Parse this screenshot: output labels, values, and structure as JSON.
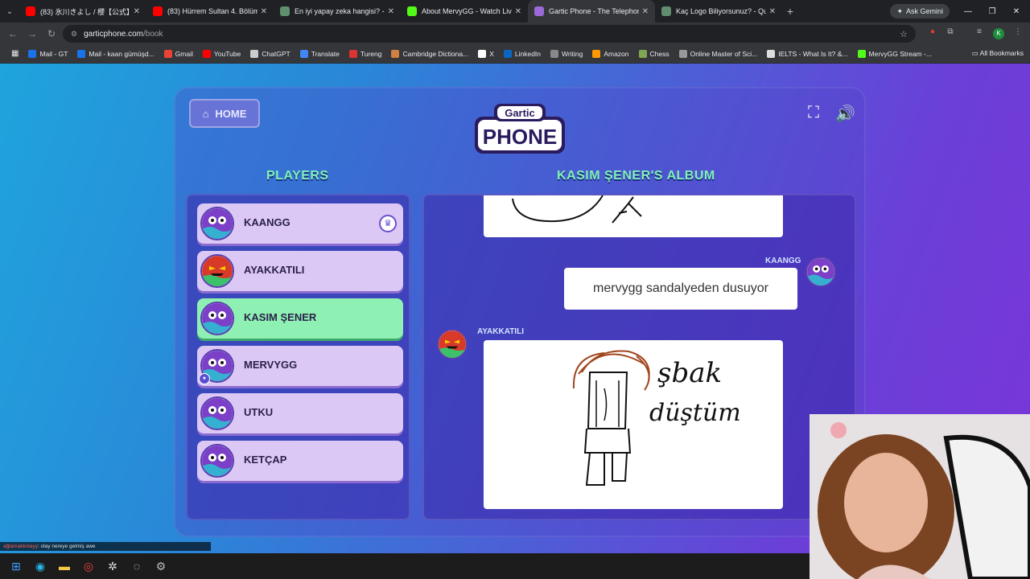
{
  "browser": {
    "tabs": [
      {
        "title": "(83) 氷川きよし / 櫻【公式】",
        "color": "#ff0000"
      },
      {
        "title": "(83) Hürrem Sultan 4. Bölüm - \\",
        "color": "#ff0000"
      },
      {
        "title": "En iyi yapay zeka hangisi? - Tie",
        "color": "#5f8f6f"
      },
      {
        "title": "About MervyGG - Watch Live o",
        "color": "#53fc18"
      },
      {
        "title": "Gartic Phone - The Telephone C",
        "color": "#9b6ad8",
        "active": true
      },
      {
        "title": "Kaç Logo Biliyorsunuz? - Quizei",
        "color": "#5f8f6f"
      }
    ],
    "gemini_label": "Ask Gemini",
    "url_host": "garticphone.com",
    "url_path": "/book",
    "profile_initial": "K",
    "bookmarks": [
      {
        "label": "Mail - GT",
        "color": "#1a73e8"
      },
      {
        "label": "Mail - kaan gümüşd...",
        "color": "#1a73e8"
      },
      {
        "label": "Gmail",
        "color": "#ea4335"
      },
      {
        "label": "YouTube",
        "color": "#ff0000"
      },
      {
        "label": "ChatGPT",
        "color": "#cccccc"
      },
      {
        "label": "Translate",
        "color": "#4285f4"
      },
      {
        "label": "Tureng",
        "color": "#d33"
      },
      {
        "label": "Cambridge Dictiona...",
        "color": "#d08040"
      },
      {
        "label": "X",
        "color": "#ffffff"
      },
      {
        "label": "LinkedIn",
        "color": "#0a66c2"
      },
      {
        "label": "Writing",
        "color": "#888888"
      },
      {
        "label": "Amazon",
        "color": "#ff9900"
      },
      {
        "label": "Chess",
        "color": "#7fa650"
      },
      {
        "label": "Online Master of Sci...",
        "color": "#999999"
      },
      {
        "label": "IELTS - What Is It? &...",
        "color": "#dddddd"
      },
      {
        "label": "MervyGG Stream -...",
        "color": "#53fc18"
      }
    ],
    "all_bookmarks": "All Bookmarks"
  },
  "game": {
    "home_label": "HOME",
    "logo_top": "Gartic",
    "logo_main": "PHONE",
    "players_title": "PLAYERS",
    "album_title": "KASIM ŞENER'S ALBUM",
    "players": [
      {
        "name": "KAANGG",
        "face": "blue",
        "host": true
      },
      {
        "name": "AYAKKATILI",
        "face": "red"
      },
      {
        "name": "KASIM ŞENER",
        "face": "blue",
        "active": true
      },
      {
        "name": "MERVYGG",
        "face": "blue",
        "mic": true
      },
      {
        "name": "UTKU",
        "face": "blue"
      },
      {
        "name": "KETÇAP",
        "face": "blue"
      }
    ],
    "album": {
      "msg1_author": "KAANGG",
      "msg1_text": "mervygg sandalyeden dusuyor",
      "msg2_author": "AYAKKATILI",
      "drawing_text_line1": "şbak",
      "drawing_text_line2": "düştüm"
    }
  },
  "stream_chat": {
    "user": "ağlamakkolayy",
    "text": ": olay nereye gelmiş awe"
  }
}
